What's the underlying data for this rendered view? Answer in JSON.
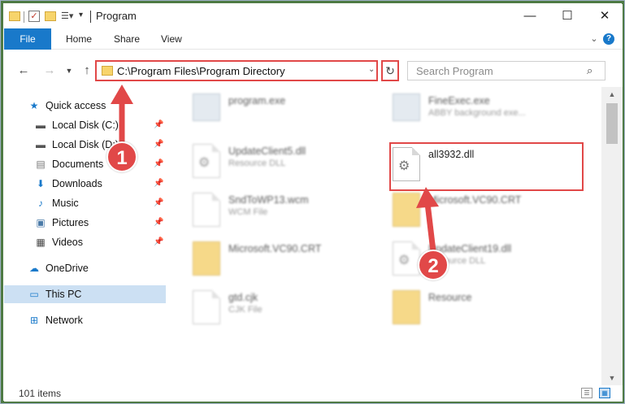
{
  "window": {
    "title": "Program",
    "controls": {
      "minimize": "—",
      "maximize": "☐",
      "close": "✕"
    }
  },
  "ribbon": {
    "tabs": [
      "File",
      "Home",
      "Share",
      "View"
    ],
    "help": "?"
  },
  "navigation": {
    "address": "C:\\Program Files\\Program Directory",
    "search_placeholder": "Search Program"
  },
  "sidebar": {
    "items": [
      {
        "label": "Quick access",
        "icon": "star-icon",
        "pinned": false
      },
      {
        "label": "Local Disk (C:)",
        "icon": "drive-icon",
        "pinned": true
      },
      {
        "label": "Local Disk (D:)",
        "icon": "drive-icon",
        "pinned": true
      },
      {
        "label": "Documents",
        "icon": "documents-icon",
        "pinned": true
      },
      {
        "label": "Downloads",
        "icon": "download-arrow-icon",
        "pinned": true
      },
      {
        "label": "Music",
        "icon": "music-note-icon",
        "pinned": true
      },
      {
        "label": "Pictures",
        "icon": "pictures-icon",
        "pinned": true
      },
      {
        "label": "Videos",
        "icon": "film-icon",
        "pinned": true
      },
      {
        "label": "OneDrive",
        "icon": "cloud-icon",
        "pinned": false
      },
      {
        "label": "This PC",
        "icon": "computer-icon",
        "pinned": false,
        "selected": true
      },
      {
        "label": "Network",
        "icon": "network-icon",
        "pinned": false
      }
    ]
  },
  "files": [
    {
      "name": "program.exe",
      "type": "",
      "icon": "exe-icon"
    },
    {
      "name": "FineExec.exe",
      "type": "ABBY background exe...",
      "icon": "exe-icon"
    },
    {
      "name": "UpdateClient5.dll",
      "type": "Resource DLL",
      "icon": "dll-icon"
    },
    {
      "name": "all3932.dll",
      "type": "",
      "icon": "dll-icon",
      "highlighted": true
    },
    {
      "name": "SndToWP13.wcm",
      "type": "WCM File",
      "icon": "file-icon"
    },
    {
      "name": "Microsoft.VC90.CRT",
      "type": "",
      "icon": "folder-icon"
    },
    {
      "name": "Microsoft.VC90.CRT",
      "type": "",
      "icon": "folder-icon"
    },
    {
      "name": "UpdateClient19.dll",
      "type": "Resource DLL",
      "icon": "dll-icon"
    },
    {
      "name": "gtd.cjk",
      "type": "CJK File",
      "icon": "file-icon"
    },
    {
      "name": "Resource",
      "type": "",
      "icon": "folder-icon"
    }
  ],
  "status": {
    "item_count": "101 items"
  },
  "callouts": [
    "1",
    "2"
  ],
  "colors": {
    "accent": "#1979ca",
    "highlight": "#e14848",
    "selected": "#cce0f3"
  }
}
